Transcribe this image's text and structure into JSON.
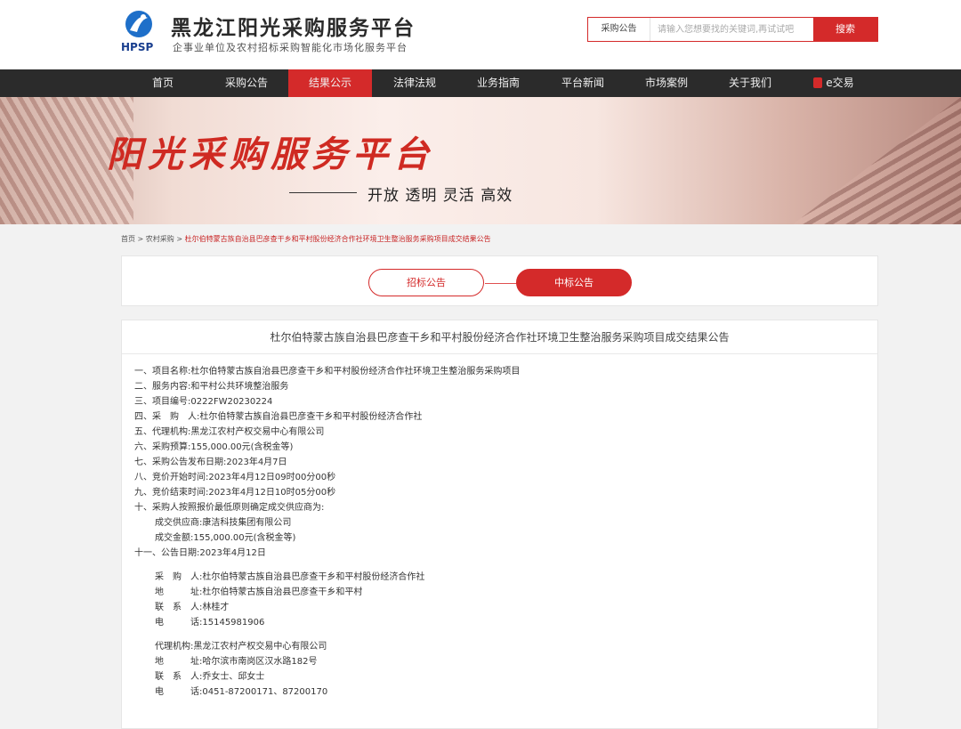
{
  "header": {
    "logo_text": "HPSP",
    "title": "黑龙江阳光采购服务平台",
    "subtitle": "企事业单位及农村招标采购智能化市场化服务平台",
    "search": {
      "category": "采购公告",
      "placeholder": "请输入您想要找的关键词,再试试吧",
      "button": "搜索"
    }
  },
  "nav": {
    "items": [
      "首页",
      "采购公告",
      "结果公示",
      "法律法规",
      "业务指南",
      "平台新闻",
      "市场案例",
      "关于我们",
      "e交易"
    ],
    "active_index": 2
  },
  "banner": {
    "title": "阳光采购服务平台",
    "slogan": "开放 透明 灵活 高效"
  },
  "breadcrumb": {
    "home": "首页",
    "sep": " > ",
    "section": "农村采购",
    "current": "杜尔伯特蒙古族自治县巴彦查干乡和平村股份经济合作社环境卫生整治服务采购项目成交结果公告"
  },
  "tabs": {
    "bid": "招标公告",
    "award": "中标公告"
  },
  "notice": {
    "title": "杜尔伯特蒙古族自治县巴彦查干乡和平村股份经济合作社环境卫生整治服务采购项目成交结果公告",
    "lines": [
      "一、项目名称:杜尔伯特蒙古族自治县巴彦查干乡和平村股份经济合作社环境卫生整治服务采购项目",
      "二、服务内容:和平村公共环境整治服务",
      "三、项目编号:0222FW20230224",
      "四、采　购　人:杜尔伯特蒙古族自治县巴彦查干乡和平村股份经济合作社",
      "五、代理机构:黑龙江农村产权交易中心有限公司",
      "六、采购预算:155,000.00元(含税金等)",
      "七、采购公告发布日期:2023年4月7日",
      "八、竞价开始时间:2023年4月12日09时00分00秒",
      "九、竞价结束时间:2023年4月12日10时05分00秒",
      "十、采购人按照报价最低原则确定成交供应商为:",
      "成交供应商:康洁科技集团有限公司",
      "成交金额:155,000.00元(含税金等)",
      "十一、公告日期:2023年4月12日",
      "采　购　人:杜尔伯特蒙古族自治县巴彦查干乡和平村股份经济合作社",
      "地　　　址:杜尔伯特蒙古族自治县巴彦查干乡和平村",
      "联　系　人:林桂才",
      "电　　　话:15145981906",
      "代理机构:黑龙江农村产权交易中心有限公司",
      "地　　　址:哈尔滨市南岗区汉水路182号",
      "联　系　人:乔女士、邱女士",
      "电　　　话:0451-87200171、87200170"
    ]
  },
  "colors": {
    "accent": "#d42a2a",
    "nav_bg": "#2b2b2b"
  }
}
